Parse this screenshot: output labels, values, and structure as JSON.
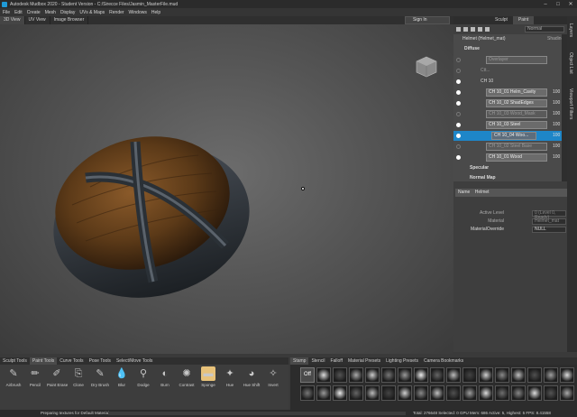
{
  "window": {
    "title": "Autodesk Mudbox 2020 - Student Version - C:/Sirecce Files/Jasmin_MasterFile.mud"
  },
  "menu": [
    "File",
    "Edit",
    "Create",
    "Mesh",
    "Display",
    "UVs & Maps",
    "Render",
    "Windows",
    "Help"
  ],
  "view_tabs": [
    "3D View",
    "UV View",
    "Image Browser"
  ],
  "signin": "Sign In",
  "right_tabs": [
    "Sculpt",
    "Paint"
  ],
  "side_tabs": [
    "Object List",
    "Layers",
    "Viewport Filters"
  ],
  "layers_toolbar": {
    "blend_mode": "Normal"
  },
  "layers": {
    "header": {
      "name": "Helmet (Helmet_mat)",
      "extra": "Shading"
    },
    "diffuse_group": "Diffuse",
    "items": [
      {
        "name": "Overlayer"
      },
      {
        "name": "Ctt..."
      },
      {
        "name": "CH 10"
      },
      {
        "name": "CH 10_01 Helm_Cavity",
        "pct": "100"
      },
      {
        "name": "CH 10_02 ShadEdges",
        "pct": "100"
      },
      {
        "name": "CH 10_03 Wood_Mask",
        "pct": "100"
      },
      {
        "name": "CH 10_03 Steel",
        "pct": "100"
      },
      {
        "name": "CH 10_04 Woo...",
        "pct": "100"
      },
      {
        "name": "CH 10_02 Steel Base",
        "pct": "100"
      },
      {
        "name": "CH 10_01 Wood",
        "pct": "100"
      }
    ],
    "groups": [
      "Specular",
      "Normal Map"
    ]
  },
  "properties": {
    "name_label": "Name",
    "name_value": "Helmet",
    "rows": [
      {
        "label": "Active Level",
        "value": "0 (Level 0, Ready)"
      },
      {
        "label": "Material",
        "value": "Helmet_mat"
      },
      {
        "label": "MaterialOverride",
        "value": "NULL"
      }
    ]
  },
  "tray_tabs": [
    "Sculpt Tools",
    "Paint Tools",
    "Curve Tools",
    "Pose Tools",
    "Select/Move Tools"
  ],
  "tray_active": "Paint Tools",
  "paint_tools": [
    {
      "label": "Airbrush",
      "icon": "airbrush-icon",
      "glyph": "✎"
    },
    {
      "label": "Pencil",
      "icon": "pencil-icon",
      "glyph": "✏"
    },
    {
      "label": "Paint Erase",
      "icon": "paint-erase-icon",
      "glyph": "✐"
    },
    {
      "label": "Clone",
      "icon": "clone-icon",
      "glyph": "⎘"
    },
    {
      "label": "Dry Brush",
      "icon": "dry-brush-icon",
      "glyph": "✎"
    },
    {
      "label": "Blur",
      "icon": "blur-icon",
      "glyph": "💧"
    },
    {
      "label": "Dodge",
      "icon": "dodge-icon",
      "glyph": "⚲"
    },
    {
      "label": "Burn",
      "icon": "burn-icon",
      "glyph": "◐"
    },
    {
      "label": "Contrast",
      "icon": "contrast-icon",
      "glyph": "✺"
    },
    {
      "label": "Sponge",
      "icon": "sponge-icon",
      "glyph": "▬"
    },
    {
      "label": "Hue",
      "icon": "hue-icon",
      "glyph": "✦"
    },
    {
      "label": "Hue Shift",
      "icon": "hue-shift-icon",
      "glyph": "◕"
    },
    {
      "label": "Invert",
      "icon": "invert-icon",
      "glyph": "✧"
    }
  ],
  "stamp_tabs": [
    "Stamp",
    "Stencil",
    "Falloff",
    "Material Presets",
    "Lighting Presets",
    "Camera Bookmarks"
  ],
  "stamp_off": "Off",
  "status": {
    "message": "Preparing textures for Default Material...",
    "stats": "Total: 276648  Selected: 0  GPU Mem: 686  Active: 5, Highest: 5  FPS: 8.41558"
  },
  "colors": {
    "accent": "#1e86c8",
    "sponge_highlight": "#e8c27a",
    "wood": "#6b4420",
    "steel": "#2a3036"
  }
}
